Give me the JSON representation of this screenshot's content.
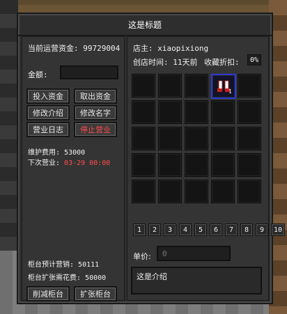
{
  "window": {
    "title": "这是标题"
  },
  "left": {
    "fund_label": "当前运营资金",
    "fund_value": "99729004",
    "amount_label": "金额",
    "buttons": {
      "deposit": "投入资金",
      "withdraw": "取出资金",
      "edit_intro": "修改介绍",
      "rename": "修改名字",
      "log": "营业日志",
      "stop": "停止营业"
    },
    "maint_label": "维护费用",
    "maint_value": "53000",
    "next_label": "下次营业",
    "next_value": "03-29 00:00",
    "forecast_label": "柜台预计营销",
    "forecast_value": "50111",
    "expand_cost_label": "柜台扩张需花费",
    "expand_cost_value": "50000",
    "reduce_button": "削减柜台",
    "expand_button": "扩张柜台"
  },
  "right": {
    "owner_label": "店主",
    "owner_name": "xiaopixiong",
    "created_label": "创店时间",
    "created_value": "11天前",
    "collect_label": "收藏折扣",
    "collect_value": "0%",
    "item_icon": "red-white-boots-icon",
    "item_count": "1",
    "pages": [
      "1",
      "2",
      "3",
      "4",
      "5",
      "6",
      "7",
      "8",
      "9",
      "10"
    ],
    "price_label": "单价",
    "price_placeholder": "0",
    "intro_text": "这是介绍"
  },
  "colors": {
    "accent_selected": "#2a3bd6",
    "danger": "#ff4b4b",
    "panel": "#343434"
  }
}
